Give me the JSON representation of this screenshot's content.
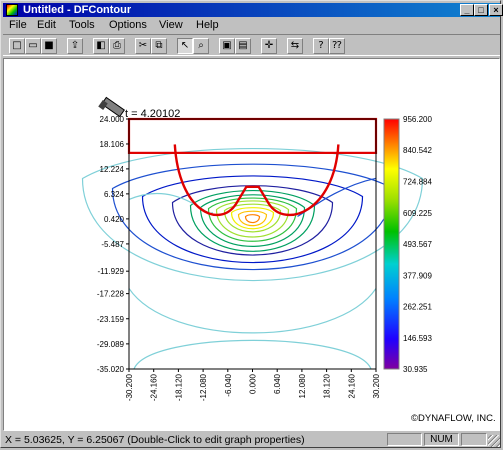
{
  "window": {
    "title": "Untitled - DFContour",
    "controls": {
      "minimize": "_",
      "maximize": "□",
      "close": "×"
    }
  },
  "menu": [
    "File",
    "Edit",
    "Tools",
    "Options",
    "View",
    "Help"
  ],
  "toolbar": {
    "buttons": [
      "new-icon",
      "open-icon",
      "save-icon",
      "export-icon",
      "print-preview-icon",
      "print-icon",
      "cut-icon",
      "copy-icon",
      "pointer-icon",
      "zoom-icon",
      "frame-icon",
      "box-icon",
      "add-icon",
      "edit-icon",
      "info-icon",
      "about-icon"
    ],
    "glyphs": [
      "□",
      "▭",
      "■",
      "⇪",
      "◧",
      "⎙",
      "✂",
      "⧉",
      "↖",
      "⌕",
      "▣",
      "▤",
      "✛",
      "⇆",
      "?",
      "⁇"
    ],
    "pressed": 8
  },
  "plot": {
    "time_label": "t = 4.20102",
    "copyright": "©DYNAFLOW, INC.",
    "y_ticks": [
      "24.000",
      "18.106",
      "12.224",
      "6.324",
      "0.420",
      "-5.487",
      "-11.929",
      "-17.228",
      "-23.159",
      "-29.089",
      "-35.020"
    ],
    "x_ticks": [
      "-30.200",
      "-24.160",
      "-18.120",
      "-12.080",
      "-6.040",
      "0.000",
      "6.040",
      "12.080",
      "18.120",
      "24.160",
      "30.200"
    ],
    "colorbar_ticks": [
      "956.200",
      "840.542",
      "724.884",
      "609.225",
      "493.567",
      "377.909",
      "262.251",
      "146.593",
      "30.935"
    ],
    "colors": {
      "outline": "#e00000",
      "levels": [
        "#7fd0d8",
        "#1e50d0",
        "#0018c8",
        "#2020a0",
        "#00a060",
        "#30c040",
        "#a0e030",
        "#f0f000",
        "#ffc000",
        "#ff8000"
      ]
    }
  },
  "chart_data": {
    "type": "heatmap",
    "title": "t = 4.20102",
    "xlim": [
      -30.2,
      30.2
    ],
    "ylim": [
      -35.02,
      24.0
    ],
    "colorbar_range": [
      30.935,
      956.2
    ],
    "colorbar_tick_values": [
      956.2,
      840.542,
      724.884,
      609.225,
      493.567,
      377.909,
      262.251,
      146.593,
      30.935
    ],
    "x_tick_values": [
      -30.2,
      -24.16,
      -18.12,
      -12.08,
      -6.04,
      0.0,
      6.04,
      12.08,
      18.12,
      24.16,
      30.2
    ],
    "y_tick_values": [
      24.0,
      18.106,
      12.224,
      6.324,
      0.42,
      -5.487,
      -11.929,
      -17.228,
      -23.159,
      -29.089,
      -35.02
    ],
    "peak_location": [
      0.0,
      0.5
    ],
    "grid": false
  },
  "status": {
    "text": "X = 5.03625, Y = 6.25067 (Double-Click to edit graph properties)",
    "cells": [
      "",
      "NUM",
      ""
    ]
  }
}
